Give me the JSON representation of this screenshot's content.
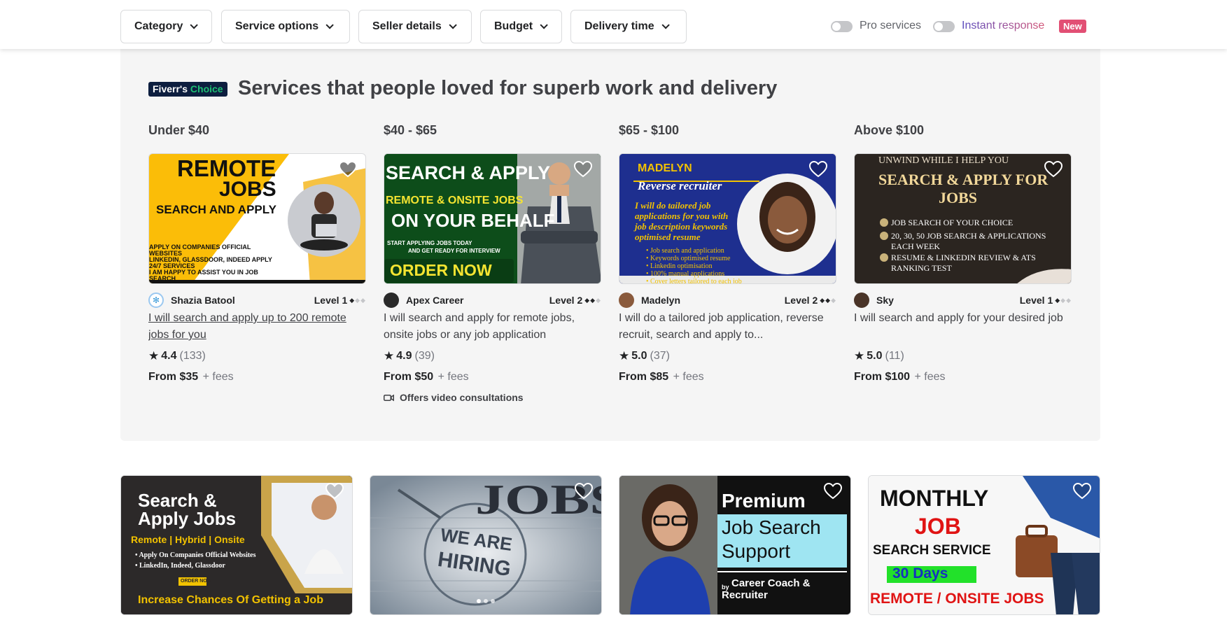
{
  "filters": {
    "category": "Category",
    "service_options": "Service options",
    "seller_details": "Seller details",
    "budget": "Budget",
    "delivery_time": "Delivery time",
    "pro_services": "Pro services",
    "instant_response": "Instant response",
    "new_badge": "New"
  },
  "choice": {
    "badge_main": "Fiverr's",
    "badge_accent": "Choice",
    "title": "Services that people loved for superb work and delivery",
    "columns": [
      {
        "price_range": "Under $40",
        "seller": "Shazia Batool",
        "level": "Level 1",
        "level_filled": 1,
        "title": "I will search and apply up to 200 remote jobs for you",
        "rating": "4.4",
        "reviews": "(133)",
        "price": "From $35",
        "fees": "+ fees",
        "thumb": {
          "l1": "REMOTE",
          "l2": "JOBS",
          "l3": "SEARCH AND APPLY",
          "b1": "APPLY ON COMPANIES OFFICIAL",
          "b2": "WEBSITES",
          "b3": "LINKEDIN, GLASSDOOR, INDEED APPLY",
          "b4": "24/7 SERVICES",
          "b5": "I AM HAPPY TO ASSIST YOU IN JOB",
          "b6": "SEARCH"
        }
      },
      {
        "price_range": "$40 - $65",
        "seller": "Apex Career",
        "level": "Level 2",
        "level_filled": 2,
        "title": "I will search and apply for remote jobs, onsite jobs or any job application",
        "rating": "4.9",
        "reviews": "(39)",
        "price": "From $50",
        "fees": "+ fees",
        "extra": "Offers video consultations",
        "thumb": {
          "l1": "SEARCH & APPLY",
          "l2": "REMOTE & ONSITE JOBS",
          "l3": "ON YOUR BEHALF",
          "l4": "START APPLYING JOBS TODAY",
          "l5": "AND GET READY  FOR INTERVIEW",
          "l6": "ORDER NOW"
        }
      },
      {
        "price_range": "$65 - $100",
        "seller": "Madelyn",
        "level": "Level 2",
        "level_filled": 2,
        "title": "I will do a tailored job application, reverse recruit, search and apply to...",
        "rating": "5.0",
        "reviews": "(37)",
        "price": "From $85",
        "fees": "+ fees",
        "thumb": {
          "l1": "MADELYN",
          "l2": "Reverse recruiter",
          "l3": "I will do tailored job",
          "l4": "applications for you with",
          "l5": "job description keywords",
          "l6": "optimised resume",
          "b1": "• Job search and application",
          "b2": "• Keywords optimised resume",
          "b3": "• Linkedin optimisation",
          "b4": "• 100% manual applications",
          "b5": "• Cover letters tailored to each job"
        }
      },
      {
        "price_range": "Above $100",
        "seller": "Sky",
        "level": "Level 1",
        "level_filled": 1,
        "title": "I will search and apply for your desired job",
        "rating": "5.0",
        "reviews": "(11)",
        "price": "From $100",
        "fees": "+ fees",
        "thumb": {
          "l1": "UNWIND WHILE I HELP YOU",
          "l2": "SEARCH & APPLY FOR",
          "l3": "JOBS",
          "b1": "JOB SEARCH OF YOUR CHOICE",
          "b2": "20, 30, 50 JOB SEARCH & APPLICATIONS",
          "b2b": "EACH WEEK",
          "b3": "RESUME & LINKEDIN REVIEW & ATS",
          "b3b": "RANKING TEST"
        }
      }
    ]
  },
  "bottom_cards": [
    {
      "l1": "Search &",
      "l2": "Apply Jobs",
      "l3": "Remote | Hybrid | Onsite",
      "b1": "• Apply On Companies Official Websites",
      "b2": "• LinkedIn, Indeed, Glassdoor",
      "btn": "ORDER NOW",
      "foot": "Increase Chances Of Getting a Job"
    },
    {
      "l1": "JOBS",
      "l2": "WE ARE",
      "l3": "HIRING"
    },
    {
      "l1": "Premium",
      "l2": "Job Search",
      "l3": "Support",
      "l4": "by",
      "l5": "Career Coach &",
      "l6": "Recruiter"
    },
    {
      "l1": "MONTHLY",
      "l2": "JOB",
      "l3": "SEARCH SERVICE",
      "l4": "30 Days",
      "l5": "REMOTE / ONSITE JOBS"
    }
  ],
  "colors": {
    "accent_green": "#1dbf73",
    "new_badge": "#e24f74",
    "section_bg": "#f5f5f5"
  }
}
